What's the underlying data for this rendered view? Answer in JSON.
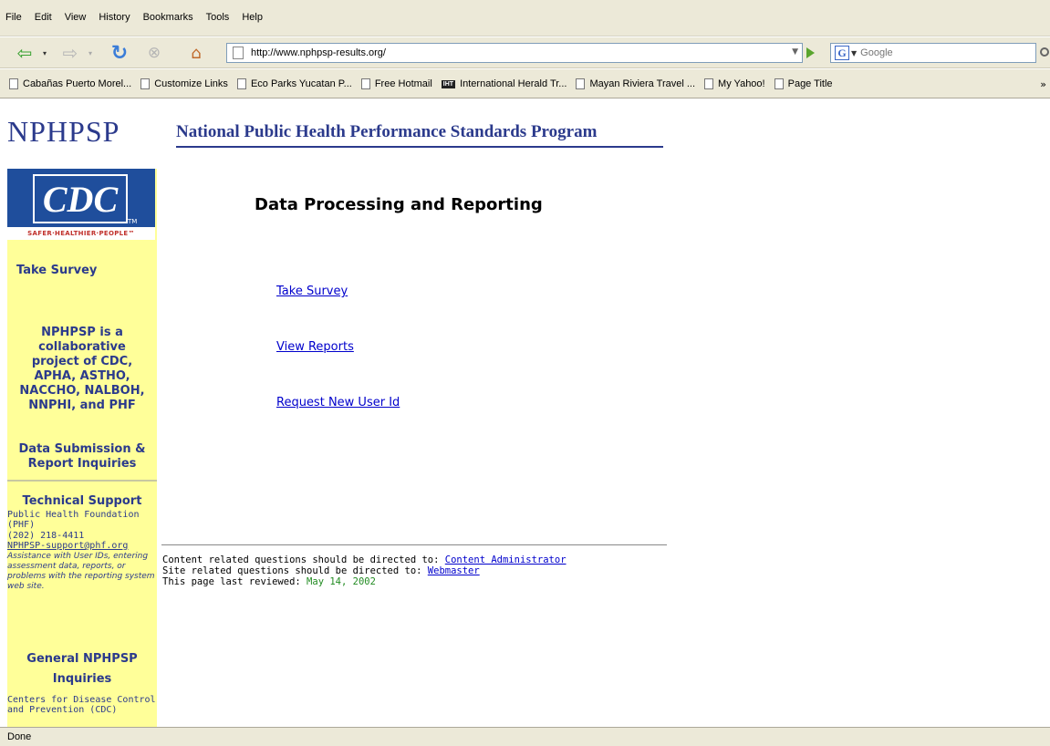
{
  "browser": {
    "menu": [
      "File",
      "Edit",
      "View",
      "History",
      "Bookmarks",
      "Tools",
      "Help"
    ],
    "url": "http://www.nphpsp-results.org/",
    "search_placeholder": "Google",
    "bookmarks": [
      "Cabañas Puerto Morel...",
      "Customize Links",
      "Eco Parks Yucatan P...",
      "Free Hotmail",
      "International Herald Tr...",
      "Mayan Riviera Travel ...",
      "My Yahoo!",
      "Page Title"
    ],
    "bookmark_iht_badge": "IHT",
    "status": "Done"
  },
  "header": {
    "logo": "NPHPSP",
    "banner": "National Public Health Performance Standards Program"
  },
  "sidebar": {
    "cdc_logo": "CDC",
    "cdc_tm": "TM",
    "cdc_tagline": "SAFER·HEALTHIER·PEOPLE™",
    "take_survey": "Take Survey",
    "collab_text": "NPHPSP is a collaborative project of CDC, APHA, ASTHO, NACCHO, NALBOH, NNPHI, and PHF",
    "data_submission": "Data Submission & Report Inquiries",
    "tech_support_heading": "Technical Support",
    "tech_org": "Public Health Foundation (PHF)",
    "tech_phone": "(202) 218-4411",
    "tech_email": "NPHPSP-support@phf.org",
    "tech_assist": "Assistance with User IDs, entering assessment data, reports, or problems with the reporting system web site.",
    "general_heading": "General NPHPSP Inquiries",
    "general_org": "Centers for Disease Control and Prevention (CDC)"
  },
  "main": {
    "title": "Data Processing and Reporting",
    "links": [
      "Take Survey",
      "View Reports",
      "Request New User Id"
    ]
  },
  "footer": {
    "content_q": "Content related questions should be directed to: ",
    "content_link": "Content Administrator",
    "site_q": "Site related questions should be directed to: ",
    "site_link": "Webmaster",
    "reviewed": "This page last reviewed: ",
    "reviewed_date": "May 14, 2002"
  },
  "colors": {
    "brand_blue": "#2b3a8c",
    "sidebar_yellow": "#ffff99",
    "link_blue": "#0000cc",
    "date_green": "#228b22"
  }
}
